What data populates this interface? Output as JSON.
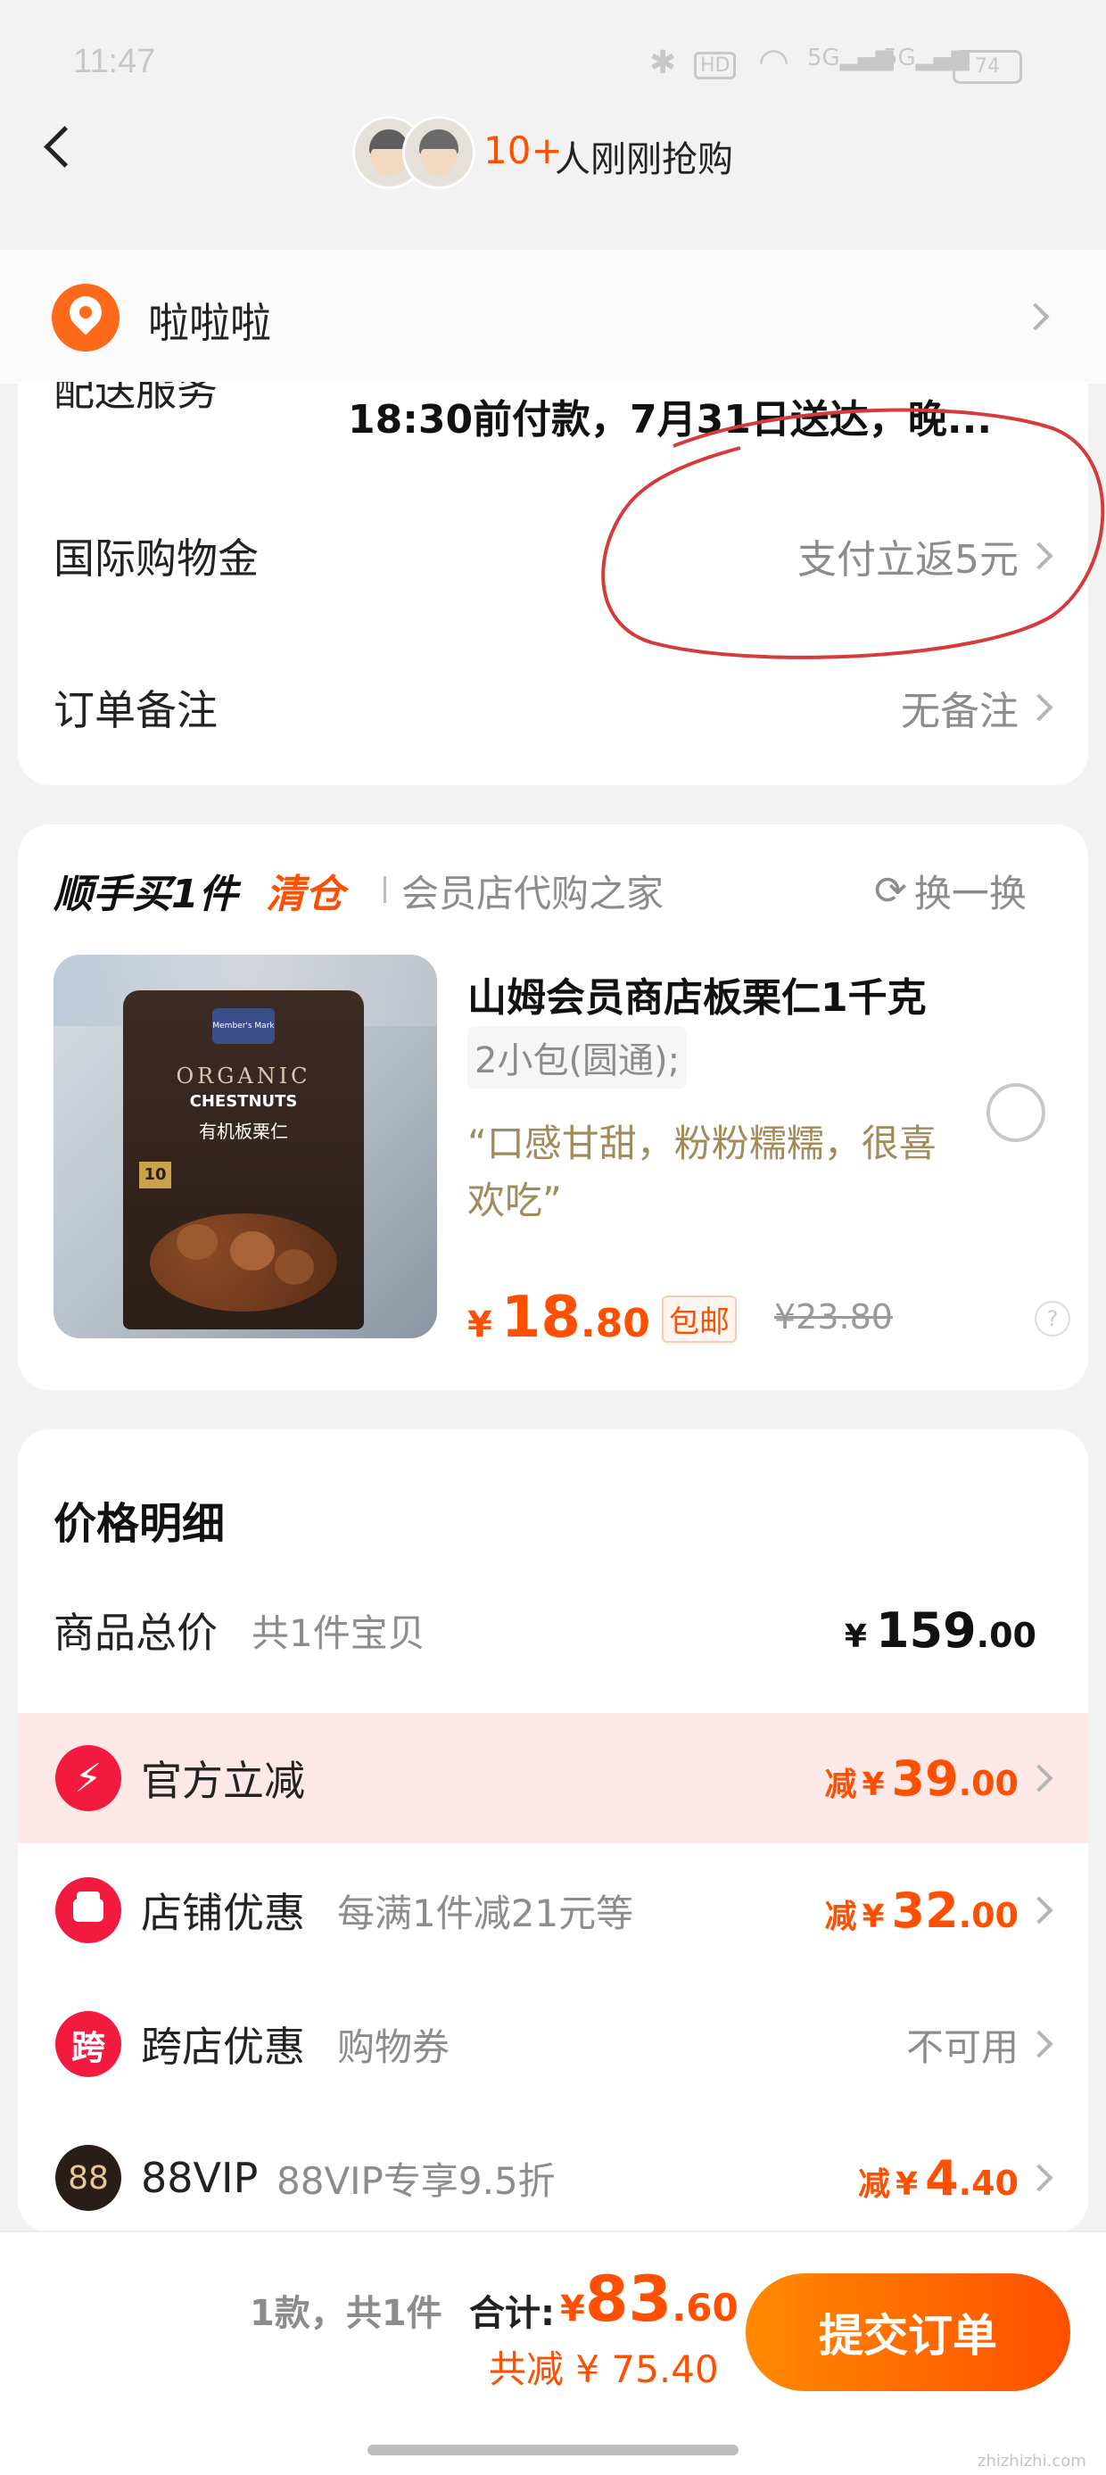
{
  "status_bar": {
    "time": "11:47",
    "battery": "74",
    "signal1": "5G",
    "signal2": "5G"
  },
  "header": {
    "count": "10+",
    "text": "人刚刚抢购"
  },
  "address": {
    "label": "啦啦啦"
  },
  "delivery": {
    "label": "配送服务",
    "value": "18:30前付款，7月31日送达，晚..."
  },
  "intl": {
    "label": "国际购物金",
    "value": "支付立返5元"
  },
  "remark": {
    "label": "订单备注",
    "value": "无备注"
  },
  "upsell": {
    "title": "顺手买1件",
    "tag": "清仓",
    "shop": "会员店代购之家",
    "swap": "换一换",
    "product": {
      "name": "山姆会员商店板栗仁1千克",
      "spec": "2小包(圆通);",
      "quote": "“口感甘甜，粉粉糯糯，很喜欢吃”",
      "currency": "¥",
      "price_int": "18",
      "price_dec": ".80",
      "shipping": "包邮",
      "orig_price": "¥23.80",
      "help": "?",
      "pkg_brand": "Member's Mark",
      "pkg_line1": "ORGANIC",
      "pkg_line2": "CHESTNUTS",
      "pkg_line3": "有机板栗仁",
      "pkg_count": "10"
    }
  },
  "price_detail": {
    "title": "价格明细",
    "rows": [
      {
        "label": "商品总价",
        "sub": "共1件宝贝",
        "prefix": "",
        "currency": "¥",
        "int": "159",
        "dec": ".00",
        "chevron": false
      },
      {
        "label": "官方立减",
        "sub": "",
        "prefix": "减",
        "currency": "¥",
        "int": "39",
        "dec": ".00",
        "chevron": true
      },
      {
        "label": "店铺优惠",
        "sub": "每满1件减21元等",
        "prefix": "减",
        "currency": "¥",
        "int": "32",
        "dec": ".00",
        "chevron": true
      },
      {
        "label": "跨店优惠",
        "sub": "购物券",
        "value": "不可用",
        "chevron": true
      },
      {
        "label": "88VIP",
        "sub": "88VIP专享9.5折",
        "prefix": "减",
        "currency": "¥",
        "int": "4",
        "dec": ".40",
        "chevron": true
      }
    ],
    "icons": {
      "kuadian_char": "跨",
      "vip_char": "88"
    }
  },
  "bottom_bar": {
    "count_text": "1款，共1件",
    "total_label": "合计:",
    "currency": "¥",
    "total_int": "83",
    "total_dec": ".60",
    "saved_text": "共减 ¥ 75.40",
    "submit": "提交订单"
  },
  "watermark": {
    "site": "zhizhizhi.com"
  },
  "colors": {
    "accent": "#ff4f00",
    "submit_gradient_start": "#ff8a00",
    "submit_gradient_end": "#ff4f00",
    "pink_row": "#fde8e8",
    "annotation": "#d63a3a"
  }
}
